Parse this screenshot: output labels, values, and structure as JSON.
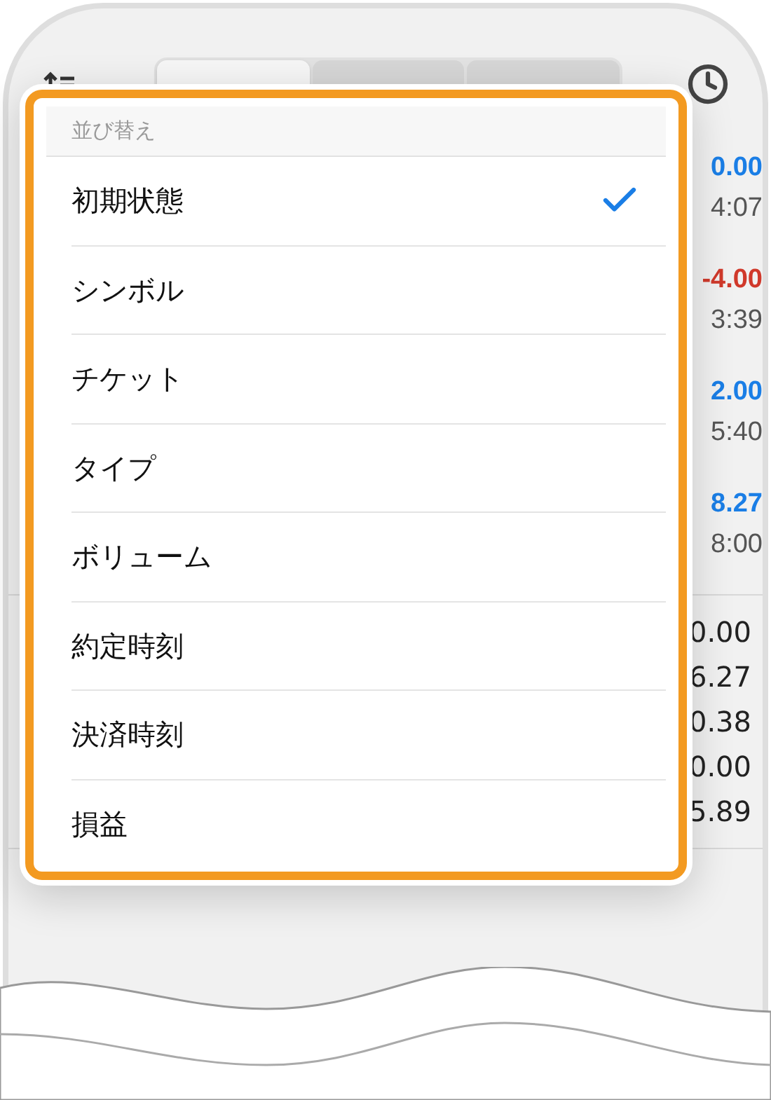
{
  "toolbar": {
    "tabs": [
      {
        "selected": true
      },
      {
        "selected": false
      },
      {
        "selected": false
      }
    ]
  },
  "positions": [
    {
      "profit": "0.00",
      "color": "#1a7ee6",
      "time": "4:07"
    },
    {
      "profit": "-4.00",
      "color": "#d0392b",
      "time": "3:39"
    },
    {
      "profit": "2.00",
      "color": "#1a7ee6",
      "time": "5:40"
    },
    {
      "profit": "8.27",
      "color": "#1a7ee6",
      "time": "8:00"
    }
  ],
  "summary": [
    "0.00",
    "6.27",
    "0.38",
    "0.00",
    "5.89"
  ],
  "sort_menu": {
    "title": "並び替え",
    "items": [
      {
        "label": "初期状態",
        "selected": true
      },
      {
        "label": "シンボル",
        "selected": false
      },
      {
        "label": "チケット",
        "selected": false
      },
      {
        "label": "タイプ",
        "selected": false
      },
      {
        "label": "ボリューム",
        "selected": false
      },
      {
        "label": "約定時刻",
        "selected": false
      },
      {
        "label": "決済時刻",
        "selected": false
      },
      {
        "label": "損益",
        "selected": false
      }
    ]
  }
}
